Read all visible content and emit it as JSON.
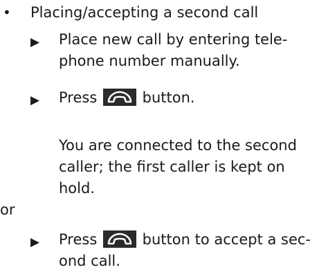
{
  "section": {
    "bullet": "•",
    "heading": "Placing/accepting a second call"
  },
  "steps": [
    {
      "arrow": "▶",
      "line1": "Place new call by entering tele-",
      "line2": "phone number manually."
    },
    {
      "arrow": "▶",
      "before": "Press",
      "after": "button.",
      "button_icon": "phone-handset-icon"
    }
  ],
  "result": {
    "line1": "You are connected to the second",
    "line2": "caller; the first caller is kept on",
    "line3": "hold."
  },
  "or_label": "or",
  "alternative": {
    "arrow": "▶",
    "before": "Press",
    "after": "button to accept a sec-",
    "line2": "ond call.",
    "button_icon": "phone-handset-icon"
  }
}
